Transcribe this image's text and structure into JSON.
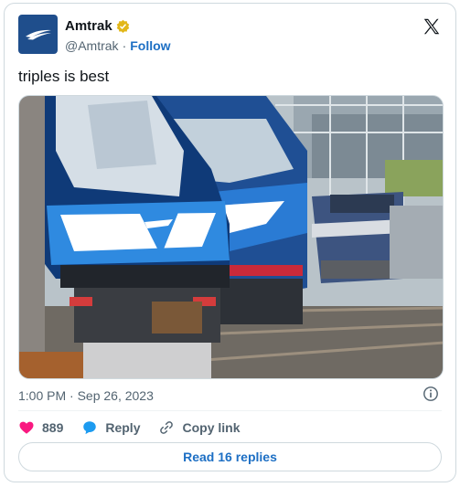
{
  "author": {
    "name": "Amtrak",
    "handle": "@Amtrak",
    "separator": "·",
    "follow_label": "Follow",
    "verified_icon": "verified-badge-icon",
    "avatar_icon": "amtrak-logo-icon"
  },
  "tweet": {
    "text": "triples is best",
    "timestamp": "1:00 PM · Sep 26, 2023",
    "media_alt_icon": "train-photo"
  },
  "actions": {
    "like_count": "889",
    "reply_label": "Reply",
    "copy_link_label": "Copy link"
  },
  "read_replies_label": "Read 16 replies",
  "colors": {
    "brand_blue": "#1d6fc4",
    "like_pink": "#f91880",
    "verified_gold": "#e2b719",
    "amtrak_blue": "#1f4e8c"
  }
}
